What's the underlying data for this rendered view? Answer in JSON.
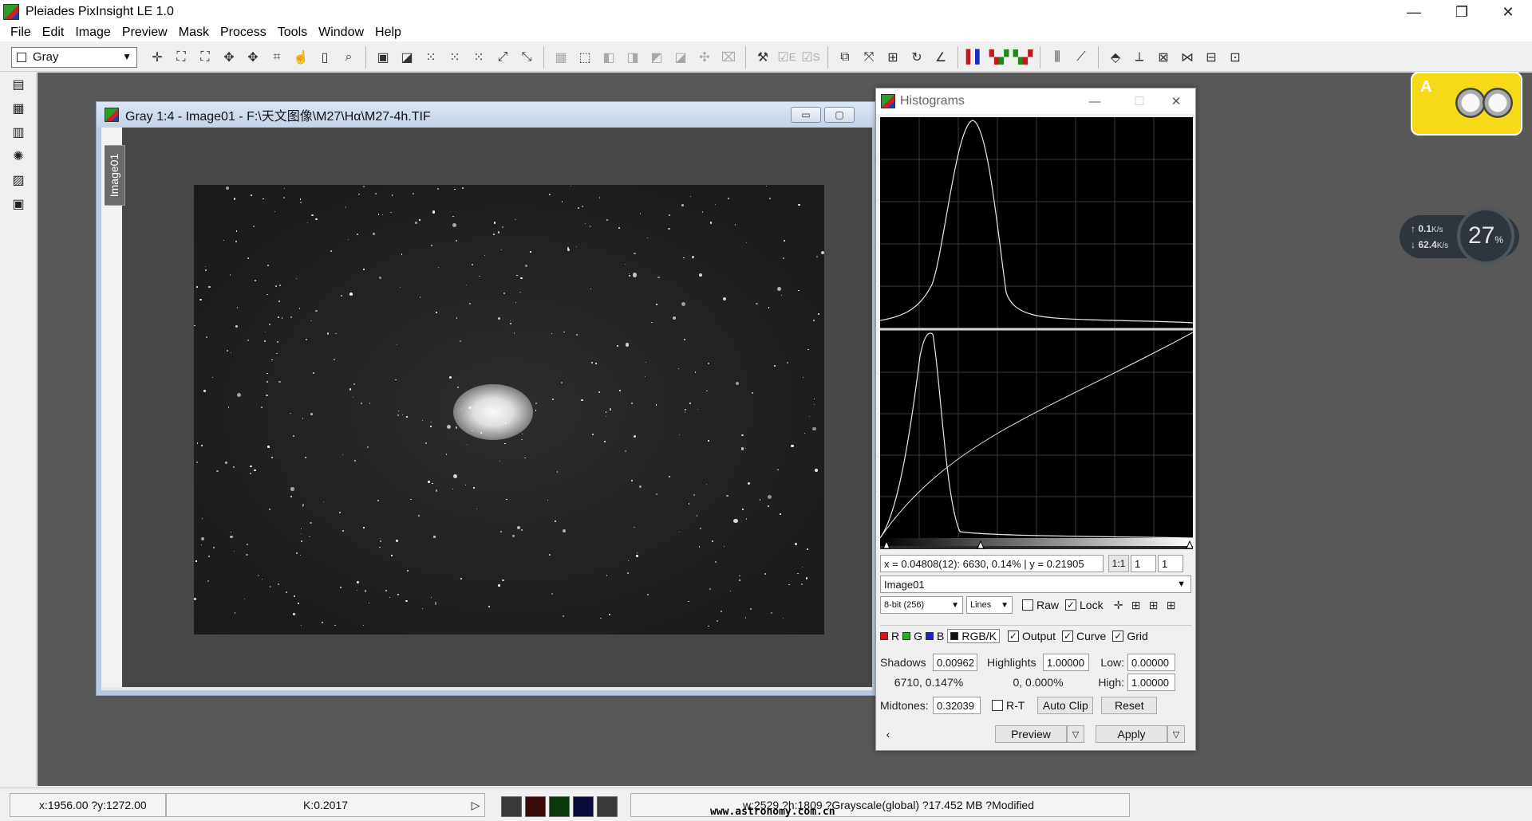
{
  "app": {
    "title": "Pleiades PixInsight LE 1.0",
    "window_controls": {
      "minimize": "—",
      "restore": "❐",
      "close": "✕"
    }
  },
  "menu": [
    "File",
    "Edit",
    "Image",
    "Preview",
    "Mask",
    "Process",
    "Tools",
    "Window",
    "Help"
  ],
  "toolbar": {
    "view_selector": "Gray",
    "mode_e": "E",
    "mode_s": "S"
  },
  "image_window": {
    "title": "Gray 1:4 - Image01 - F:\\天文图像\\M27\\Hα\\M27-4h.TIF",
    "view_tab": "Image01",
    "controls": {
      "minimize": "▭",
      "maximize": "▢",
      "close": "✕"
    }
  },
  "histograms": {
    "title": "Histograms",
    "readout": "x = 0.04808(12): 6630, 0.14% | y = 0.21905",
    "zoom_label": "1:1",
    "zoom_h": "1",
    "zoom_v": "1",
    "view": "Image01",
    "resolution": "8-bit (256)",
    "graph_style": "Lines",
    "raw_label": "Raw",
    "lock_label": "Lock",
    "channels": {
      "r": "R",
      "g": "G",
      "b": "B",
      "rgbk": "RGB/K"
    },
    "output_label": "Output",
    "curve_label": "Curve",
    "grid_label": "Grid",
    "shadows_label": "Shadows",
    "shadows_value": "0.00962",
    "shadows_clip": "6710,  0.147%",
    "highlights_label": "Highlights",
    "highlights_value": "1.00000",
    "highlights_clip": "0,  0.000%",
    "low_label": "Low:",
    "low_value": "0.00000",
    "high_label": "High:",
    "high_value": "1.00000",
    "midtones_label": "Midtones:",
    "midtones_value": "0.32039",
    "rt_label": "R-T",
    "autoclip_label": "Auto Clip",
    "reset_label": "Reset",
    "preview_label": "Preview",
    "apply_label": "Apply",
    "lock_checked": true,
    "raw_checked": false,
    "output_checked": true,
    "curve_checked": true,
    "grid_checked": true,
    "rt_checked": false
  },
  "netspeed": {
    "up": "0.1",
    "down": "62.4",
    "unit": "K/s",
    "cpu_value": "27",
    "cpu_unit": "%"
  },
  "status": {
    "coords": "x:1956.00 ?y:1272.00",
    "k_value": "K:0.2017",
    "info": "w:2529 ?h:1809 ?Grayscale(global) ?17.452 MB ?Modified",
    "watermark": "www.astronomy.com.cn",
    "swatch_colors": [
      "#3a3a3a",
      "#3a0a0a",
      "#0a3a0a",
      "#0a0a3a",
      "#3a3a3a"
    ]
  }
}
